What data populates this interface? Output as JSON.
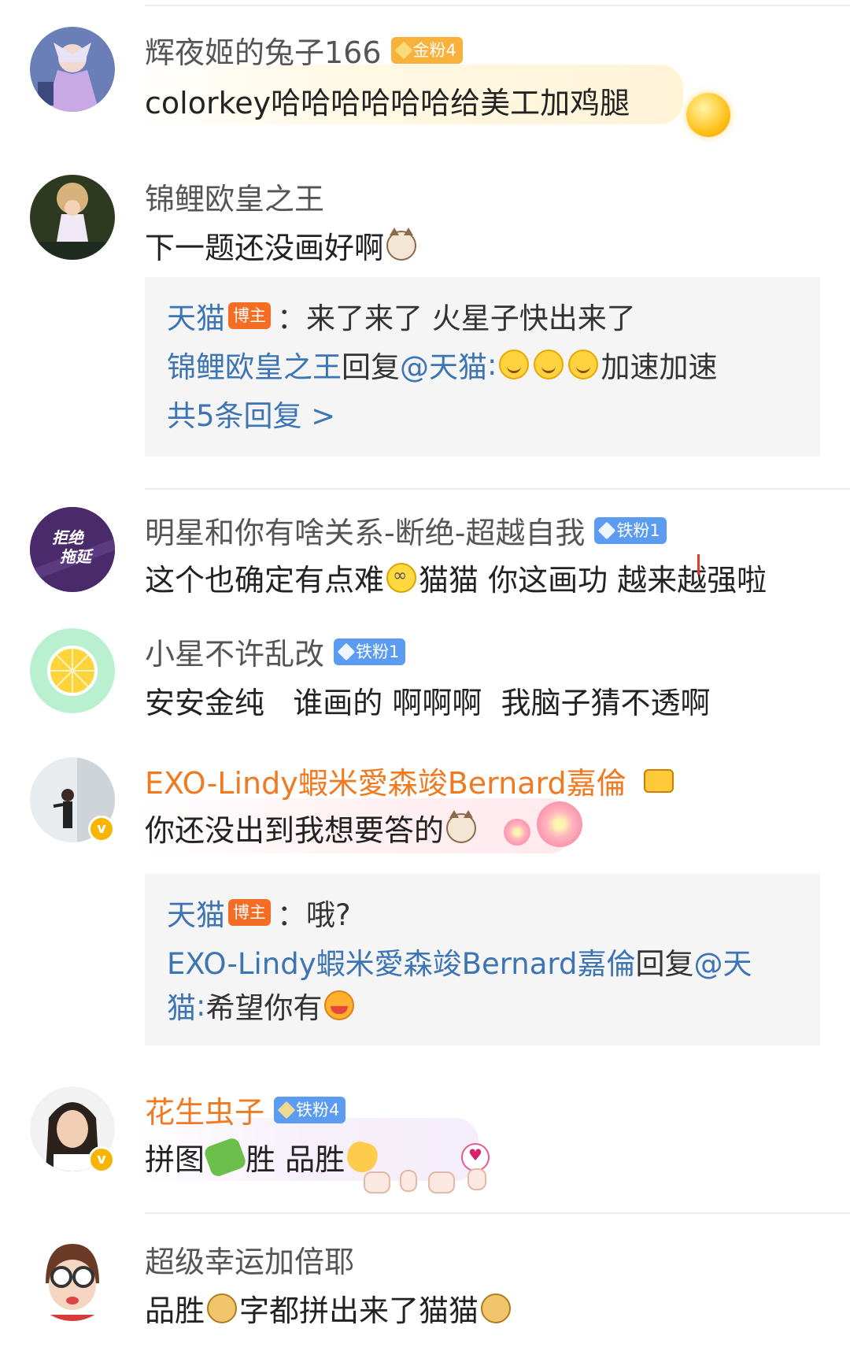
{
  "comments": [
    {
      "username": "辉夜姬的兔子166",
      "badge": "金粉4",
      "text": "colorkey哈哈哈哈哈哈给美工加鸡腿"
    },
    {
      "username": "锦鲤欧皇之王",
      "text": "下一题还没画好啊",
      "replies": [
        {
          "author": "天猫",
          "author_tag": "博主",
          "sep": "：",
          "text": "来了来了 火星子快出来了"
        },
        {
          "author": "锦鲤欧皇之王",
          "mid": "回复",
          "mention": "@天猫",
          "sep": ":",
          "text": "加速加速"
        }
      ],
      "more": "共5条回复 >"
    },
    {
      "username": "明星和你有啥关系-断绝-超越自我",
      "badge": "铁粉1",
      "avatar_text": [
        "拒绝",
        "拖延"
      ],
      "text_a": "这个也确定有点难",
      "text_b": "猫猫 你这画功 越来越强啦"
    },
    {
      "username": "小星不许乱改",
      "badge": "铁粉1",
      "text": "安安金纯   谁画的 啊啊啊  我脑子猜不透啊"
    },
    {
      "username": "EXO-Lindy蝦米愛森竣Bernard嘉倫",
      "verified": "v",
      "text": "你还没出到我想要答的",
      "replies": [
        {
          "author": "天猫",
          "author_tag": "博主",
          "sep": "：",
          "text": "哦?"
        },
        {
          "author": "EXO-Lindy蝦米愛森竣Bernard嘉倫",
          "mid": "回复",
          "mention": "@天",
          "text2_mention": "猫",
          "sep": ":",
          "text": "希望你有"
        }
      ]
    },
    {
      "username": "花生虫子",
      "badge": "铁粉4",
      "verified": "v",
      "text_a": "拼图",
      "text_b": "胜 品胜"
    },
    {
      "username": "超级幸运加倍耶",
      "text_a": "品胜",
      "text_b": "字都拼出来了猫猫"
    }
  ],
  "colors": {
    "name_gray": "#555555",
    "name_orange": "#f07a22",
    "link_blue": "#3c74b4",
    "reply_bg": "#f5f5f5",
    "blogger_tag": "#f46d24",
    "gold_badge": "#f8b13a",
    "iron_badge": "#5b9cf2",
    "verified": "#f7b500"
  }
}
